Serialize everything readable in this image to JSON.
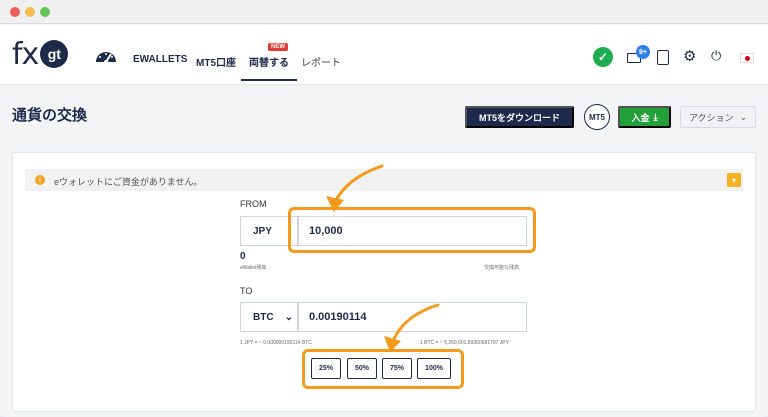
{
  "logo": {
    "fx": "fx",
    "gt": "gt"
  },
  "nav": {
    "ewallets": "EWALLETS",
    "mt5": "MT5口座",
    "exchange": "両替する",
    "new_badge": "NEW",
    "reports": "レポート"
  },
  "header_icons": {
    "mail_count": "9+",
    "check": "✓"
  },
  "page": {
    "title": "通貨の交換",
    "download_button": "MT5をダウンロード",
    "mt5_badge": "MT5",
    "deposit_button": "入金",
    "action_button": "アクション"
  },
  "alert": {
    "icon": "i",
    "text": "eウォレットにご資金がありません。"
  },
  "form": {
    "from_label": "FROM",
    "from_currency": "JPY",
    "from_amount": "10,000",
    "balance_value": "0",
    "balance_label": "eWallet残高",
    "exchangeable_label": "交換可能な残高",
    "to_label": "TO",
    "to_currency": "BTC",
    "to_amount": "0.00190114",
    "rate_left": "1 JPY = ~ 0.000000190114 BTC",
    "rate_right": "1 BTC = ~ 5,260,001.89360681797 JPY"
  },
  "percent_buttons": [
    "25%",
    "50%",
    "75%",
    "100%"
  ],
  "colors": {
    "navy": "#1e2a4a",
    "green": "#23a03a",
    "highlight": "#f39a1c",
    "alert": "#f4b31c"
  }
}
